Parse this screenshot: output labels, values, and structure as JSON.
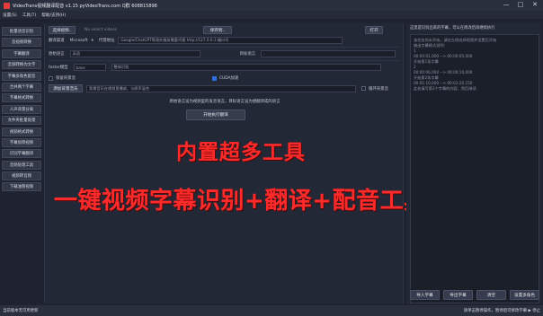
{
  "window": {
    "title": "VideoTrans视频翻译配音 v1.15  pyVideoTrans.com    Q群 608815898",
    "controls": [
      "—",
      "□",
      "✕"
    ]
  },
  "menu": [
    "设置(S)",
    "工具(T)",
    "帮助/支持(H)"
  ],
  "sidebar": [
    "批量语音识别",
    "音视频转换",
    "字幕翻译",
    "音频转换为文字",
    "字幕多角色配音",
    "合并两个字幕",
    "字幕格式转换",
    "人声背景分离",
    "文件夹批量处理",
    "视频格式转换",
    "字幕加到视频",
    "识别字幕翻译",
    "音频处理工具",
    "视频转音频",
    "下载油管视频"
  ],
  "form": {
    "select_video_btn": "选择视频..",
    "no_video": "No select videos",
    "save_to_btn": "保存到..",
    "open_btn": "打开",
    "translate_channel_label": "翻译渠道",
    "translate_channel_value": "Microsoft",
    "proxy_label": "代理地址",
    "proxy_placeholder": "Google/ChatGPT等境外服务需要代理 http://127.0.0.1:端口号",
    "source_lang_label": "原始语言",
    "source_lang_value": "英语",
    "target_lang_label": "目标语言",
    "target_lang_value": "-",
    "recog_model": "faster模型",
    "model_size": "base",
    "recog_mode": "整体识别",
    "keep_bg_label": "保留背景音",
    "cuda_label": "CUDA加速",
    "add_bg_btn": "添加背景音乐",
    "bg_placeholder": "背景音乐在视频里播放，与原声混合",
    "loop_label": "循环背景音",
    "notice_1": "原始语言设为视频里的发音语言，目标语言设为想翻译成的语言",
    "start_btn": "开始执行翻译"
  },
  "overlay": {
    "line1": "内置超多工具",
    "line2": "一键视频字幕识别+翻译+配音工具"
  },
  "right": {
    "hint": "这里是识别出来的字幕，可以在修改后再继续执行",
    "srt_lines": [
      "该任务尚未开始，请在左侧选择视频并设置后开始",
      "",
      "输出字幕格式说明：",
      "",
      "1",
      "00:00:01,000 --> 00:00:05,000",
      "开始第1条字幕",
      "",
      "2",
      "00:00:06,000 --> 00:00:10,000",
      "开始第2条字幕",
      "",
      "00:01:10,000 --> 00:01:20,150",
      "此处填写第2个字幕的内容，然后继续"
    ],
    "buttons": [
      "导入字幕",
      "导出字幕",
      "清空",
      "设置多角色"
    ]
  },
  "status": {
    "left": "当前版本无可用更新",
    "right": "请单击暂停操作，暂停后可修改字幕 ▶ 停止"
  }
}
